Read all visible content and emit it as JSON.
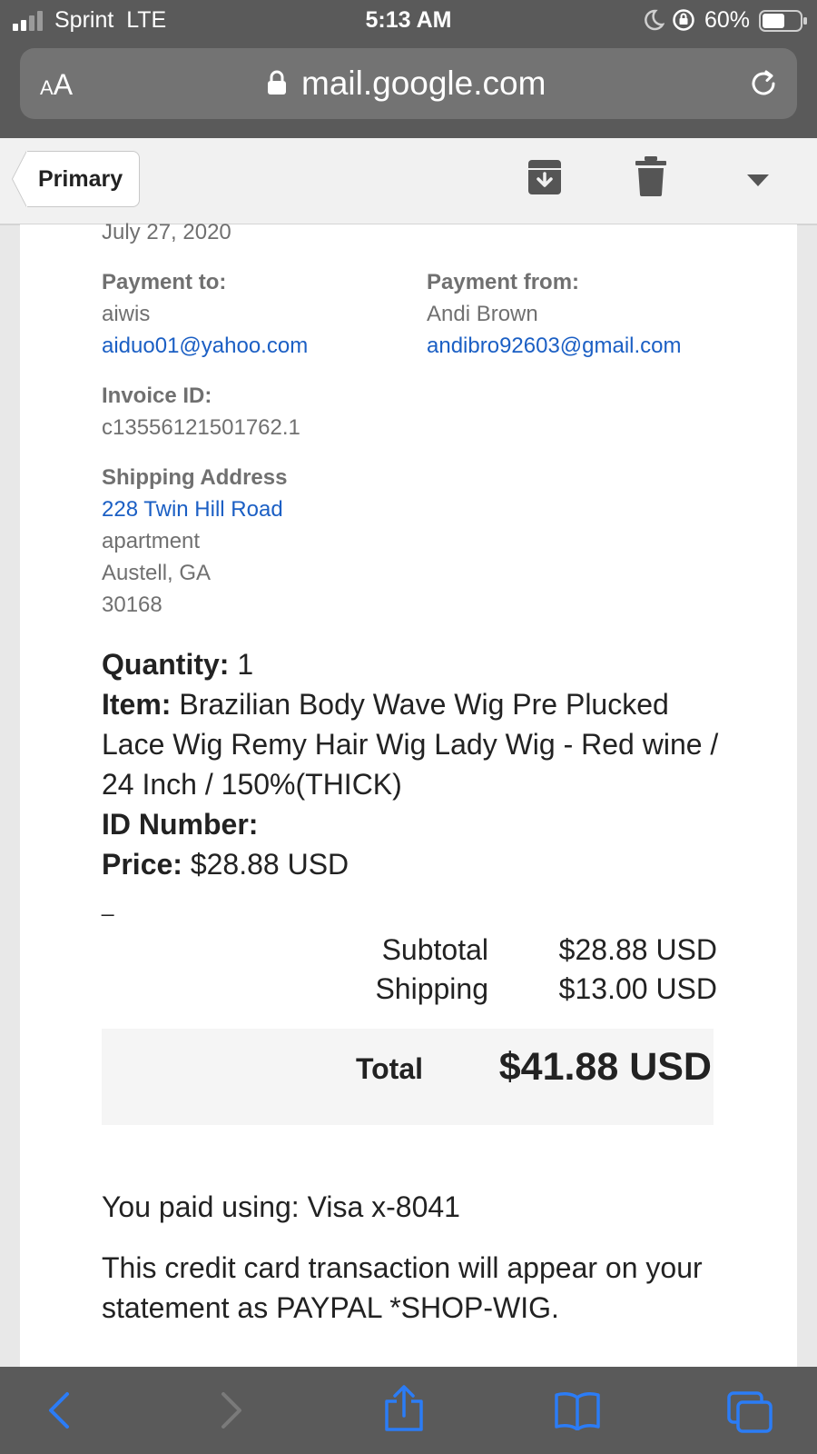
{
  "status_bar": {
    "carrier": "Sprint",
    "network": "LTE",
    "time": "5:13 AM",
    "battery": "60%",
    "battery_level": 0.6
  },
  "browser": {
    "text_size_label_small": "A",
    "text_size_label_large": "A",
    "host": "mail.google.com"
  },
  "toolbar": {
    "back_label": "Primary"
  },
  "email": {
    "date": "July 27, 2020",
    "payment_to": {
      "label": "Payment to:",
      "name": "aiwis",
      "email": "aiduo01@yahoo.com"
    },
    "payment_from": {
      "label": "Payment from:",
      "name": "Andi Brown",
      "email": "andibro92603@gmail.com"
    },
    "invoice": {
      "label": "Invoice ID:",
      "value": "c13556121501762.1"
    },
    "shipping_address": {
      "label": "Shipping Address",
      "line1": "228 Twin Hill Road",
      "line2": "apartment",
      "line3": "Austell, GA",
      "line4": "30168"
    },
    "item": {
      "quantity_label": "Quantity:",
      "quantity": "1",
      "item_label": "Item:",
      "item_name": "Brazilian Body Wave Wig Pre Plucked Lace Wig Remy Hair Wig Lady Wig - Red wine / 24 Inch / 150%(THICK)",
      "id_label": "ID Number:",
      "price_label": "Price:",
      "price": "$28.88 USD"
    },
    "separator": "_",
    "summary": {
      "subtotal_label": "Subtotal",
      "subtotal": "$28.88 USD",
      "shipping_label": "Shipping",
      "shipping": "$13.00 USD",
      "total_label": "Total",
      "total": "$41.88 USD"
    },
    "paid_using": "You paid using: Visa x-8041",
    "statement_note": "This credit card transaction will appear on your statement as PAYPAL *SHOP-WIG."
  },
  "colors": {
    "chrome_bg": "#5a5a5a",
    "link": "#1b5fc4",
    "safari_blue": "#2b7cf6"
  },
  "icons": {
    "archive": "archive-icon",
    "trash": "trash-icon",
    "more": "chevron-down-icon",
    "back": "back-arrow-icon",
    "forward": "forward-arrow-icon",
    "share": "share-icon",
    "bookmarks": "book-icon",
    "tabs": "tabs-icon"
  }
}
